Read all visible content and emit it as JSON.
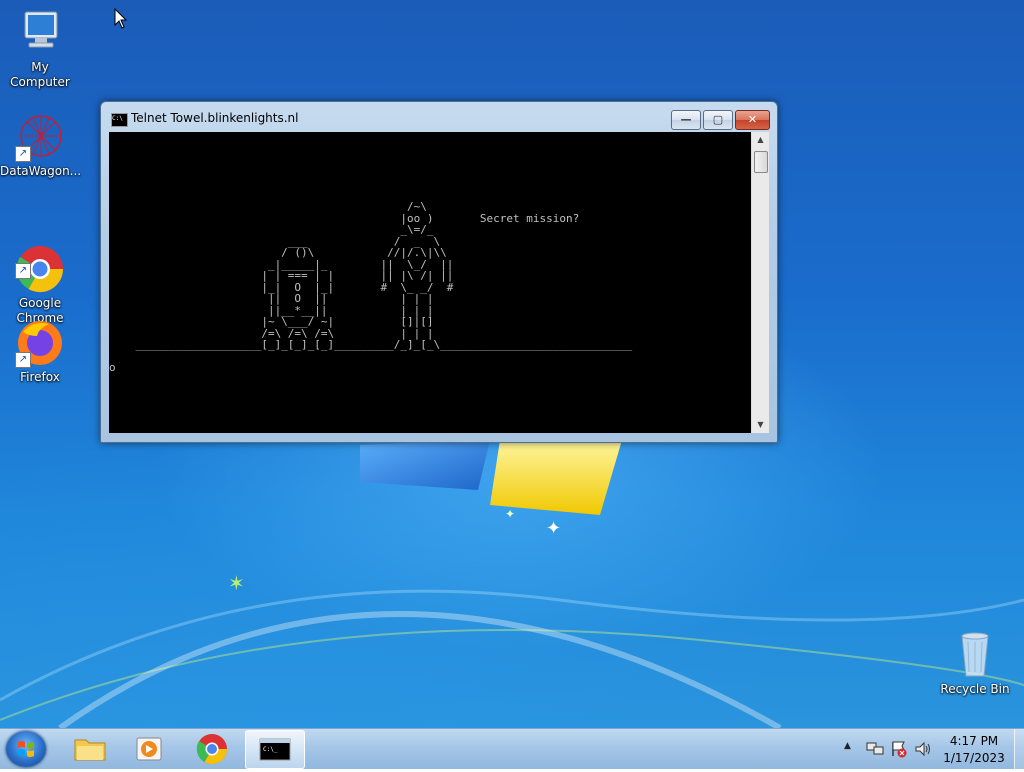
{
  "desktop": {
    "icons": [
      {
        "label": "My Computer",
        "icon": "computer-icon"
      },
      {
        "label": "DataWagon...",
        "icon": "datawagon-icon"
      },
      {
        "label": "Google\nChrome",
        "icon": "chrome-icon"
      },
      {
        "label": "Firefox",
        "icon": "firefox-icon"
      },
      {
        "label": "Recycle Bin",
        "icon": "recycle-bin-icon"
      }
    ]
  },
  "window": {
    "title": "Telnet Towel.blinkenlights.nl",
    "buttons": {
      "minimize": "—",
      "maximize": "▢",
      "close": "✕"
    },
    "console_text": "\n\n\n\n\n\n                                             /~\\\n                                            |oo )       Secret mission?\n                                            _\\=/_\n                           ___             /  _  \\\n                          / ()\\           //|/.\\|\\\\\n                        _|_____|_        ||  \\_/  ||\n                       | | === | |       || |\\ /| ||\n                       |_|  O  |_|       #  \\_ _/  #\n                        ||  O  ||           | | |\n                        ||__*__||           | | |\n                       |~ \\___/ ~|          []|[]\n                       /=\\ /=\\ /=\\          | | |\n    ___________________[_]_[_]_[_]_________/_]_[_\\_____________________________\n\no"
  },
  "taskbar": {
    "apps": [
      "start-button",
      "file-explorer",
      "media-player",
      "chrome",
      "command-prompt"
    ],
    "clock_time": "4:17 PM",
    "clock_date": "1/17/2023",
    "tray_arrow": "▲"
  },
  "colors": {
    "console_bg": "#000000",
    "console_fg": "#c0c0c0",
    "desktop_bg": "#1a6ccc"
  }
}
